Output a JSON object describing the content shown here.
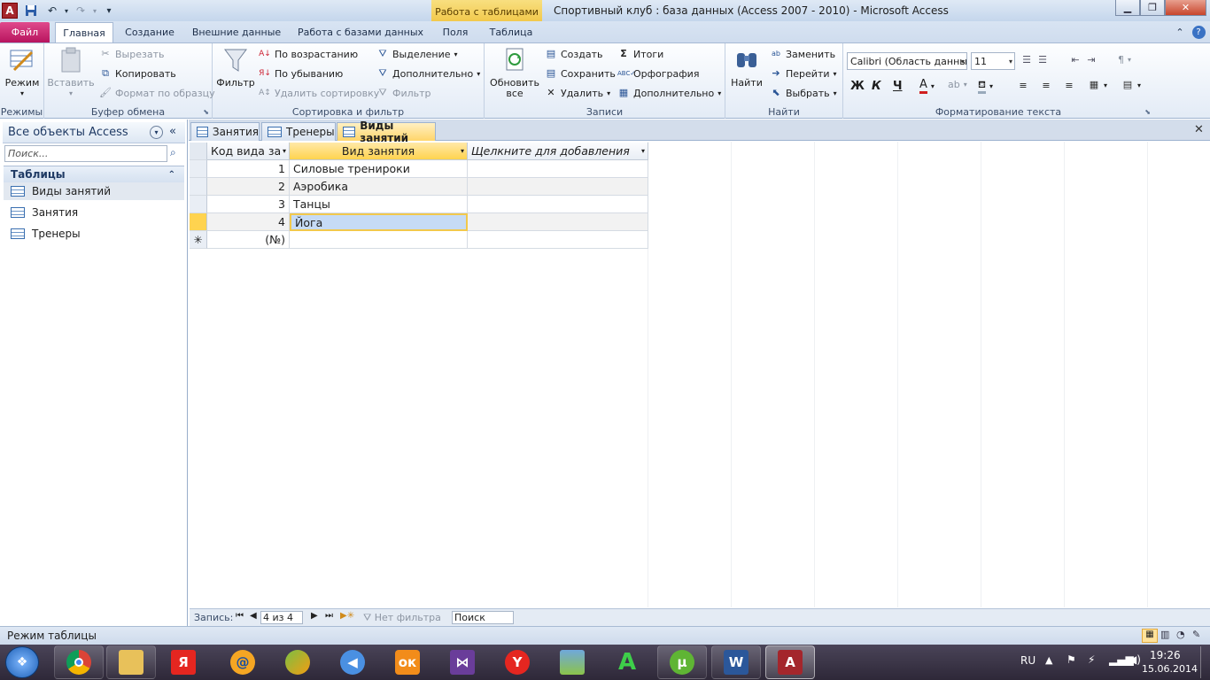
{
  "window": {
    "title": "Спортивный клуб : база данных (Access 2007 - 2010)  -  Microsoft Access",
    "context_tab": "Работа с таблицами"
  },
  "ribbon_tabs": [
    "Файл",
    "Главная",
    "Создание",
    "Внешние данные",
    "Работа с базами данных",
    "Поля",
    "Таблица"
  ],
  "ribbon": {
    "groups": {
      "views": "Режимы",
      "clipboard": "Буфер обмена",
      "sort_filter": "Сортировка и фильтр",
      "records": "Записи",
      "find": "Найти",
      "text_format": "Форматирование текста"
    },
    "view_btn": "Режим",
    "paste_btn": "Вставить",
    "cut": "Вырезать",
    "copy": "Копировать",
    "format_painter": "Формат по образцу",
    "filter_btn": "Фильтр",
    "ascending": "По возрастанию",
    "descending": "По убыванию",
    "remove_sort": "Удалить сортировку",
    "selection": "Выделение",
    "advanced": "Дополнительно",
    "toggle_filter": "Фильтр",
    "refresh_line1": "Обновить",
    "refresh_line2": "все",
    "new": "Создать",
    "save": "Сохранить",
    "delete": "Удалить",
    "totals": "Итоги",
    "spelling": "Орфография",
    "more": "Дополнительно",
    "find_btn": "Найти",
    "replace": "Заменить",
    "goto": "Перейти",
    "select": "Выбрать",
    "font_name": "Calibri (Область данны",
    "font_size": "11",
    "bold": "Ж",
    "italic": "К",
    "underline": "Ч"
  },
  "nav_pane": {
    "header": "Все объекты Access",
    "search_placeholder": "Поиск...",
    "section": "Таблицы",
    "items": [
      "Виды занятий",
      "Занятия",
      "Тренеры"
    ]
  },
  "doc_tabs": [
    "Занятия",
    "Тренеры",
    "Виды занятий"
  ],
  "datasheet": {
    "columns": [
      "Код вида за",
      "Вид занятия",
      "Щелкните для добавления"
    ],
    "rows": [
      {
        "id": "1",
        "name": "Силовые тренироки"
      },
      {
        "id": "2",
        "name": "Аэробика"
      },
      {
        "id": "3",
        "name": "Танцы"
      },
      {
        "id": "4",
        "name": "Йога"
      }
    ],
    "new_row_id": "(№)",
    "selected_row": 4
  },
  "record_nav": {
    "label": "Запись:",
    "position": "4 из 4",
    "filter": "Нет фильтра",
    "search": "Поиск"
  },
  "status": {
    "mode": "Режим таблицы"
  },
  "taskbar": {
    "language": "RU",
    "time": "19:26",
    "date": "15.06.2014",
    "apps": [
      "chrome",
      "explorer",
      "yandex",
      "mail",
      "hangouts",
      "audio",
      "odnoklassniki",
      "visual-studio",
      "yandex-browser",
      "photos",
      "app-a",
      "utorrent",
      "word",
      "access"
    ]
  },
  "colors": {
    "file_tab": "#c31a63",
    "context_tab": "#f2c94c",
    "active_doc_tab": "#ffd56a",
    "selected_cell": "#c6dbf5"
  }
}
